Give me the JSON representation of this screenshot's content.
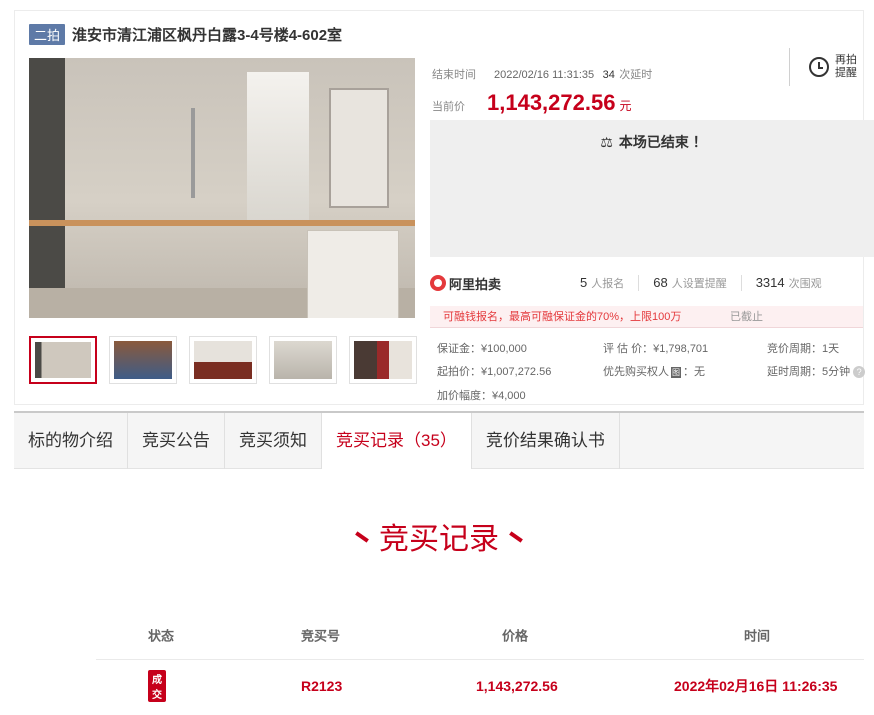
{
  "header": {
    "badge": "二拍",
    "title": "淮安市清江浦区枫丹白露3-4号楼4-602室"
  },
  "gallery": {
    "thumb_count": 5
  },
  "auction": {
    "end_label": "结束时间",
    "end_time": "2022/02/16 11:31:35",
    "extensions_num": "34",
    "extensions_unit": "次延时",
    "current_label": "当前价",
    "current_price": "1,143,272.56",
    "currency_unit": "元",
    "remind_label": "再拍提醒",
    "ended_text": "本场已结束 ！",
    "ended_icon": "gavel-icon"
  },
  "stats": {
    "logo_text": "阿里拍卖",
    "signups_num": "5",
    "signups_unit": "人报名",
    "reminders_num": "68",
    "reminders_unit": "人设置提醒",
    "views_num": "3314",
    "views_unit": "次围观"
  },
  "deposit_notice": {
    "text": "可融钱报名，最高可融保证金的70%，上限100万",
    "status": "已截止"
  },
  "info": {
    "deposit": "保证金：¥100,000",
    "appraisal": "评 估 价：¥1,798,701",
    "cycle": "竞价周期：1天",
    "start_price": "起拍价：¥1,007,272.56",
    "priority_label": "优先购买权人",
    "priority_tag": "图",
    "priority_value": "：无",
    "delay": "延时周期：5分钟",
    "increment": "加价幅度：¥4,000"
  },
  "tabs": [
    {
      "label": "标的物介绍"
    },
    {
      "label": "竞买公告"
    },
    {
      "label": "竞买须知"
    },
    {
      "label": "竞买记录（35）"
    },
    {
      "label": "竞价结果确认书"
    }
  ],
  "records": {
    "title": "竞买记录",
    "columns": {
      "status": "状态",
      "bid_no": "竞买号",
      "price": "价格",
      "time": "时间"
    },
    "rows": [
      {
        "status": "成交",
        "bid_no": "R2123",
        "price": "1,143,272.56",
        "time": "2022年02月16日 11:26:35"
      }
    ]
  },
  "colors": {
    "accent": "#c6001b",
    "badge": "#5e7aa7"
  }
}
